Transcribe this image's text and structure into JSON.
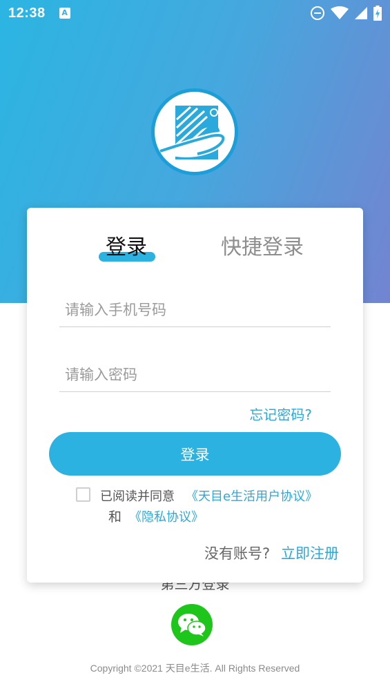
{
  "status_bar": {
    "time": "12:38",
    "notification_icon": "A",
    "icons": [
      "do-not-disturb-icon",
      "wifi-icon",
      "signal-icon",
      "battery-icon"
    ]
  },
  "logo": {
    "icon": "app-logo"
  },
  "tabs": {
    "login": "登录",
    "quick_login": "快捷登录",
    "active": "login"
  },
  "form": {
    "phone_placeholder": "请输入手机号码",
    "phone_value": "",
    "password_placeholder": "请输入密码",
    "password_value": "",
    "forgot_password": "忘记密码?",
    "login_button": "登录"
  },
  "agreement": {
    "checked": false,
    "prefix": "已阅读并同意",
    "user_agreement": "《天目e生活用户协议》",
    "conjunction": "和",
    "privacy_agreement": "《隐私协议》"
  },
  "register": {
    "question": "没有账号?",
    "link": "立即注册"
  },
  "third_party": {
    "label": "第三方登录",
    "wechat_icon": "wechat-icon"
  },
  "footer": {
    "copyright": "Copyright ©2021 天目e生活. All Rights Reserved"
  },
  "colors": {
    "accent": "#2bb2e1",
    "gradient_start": "#2bb5e2",
    "gradient_end": "#7384d1",
    "wechat": "#1ec61b"
  }
}
